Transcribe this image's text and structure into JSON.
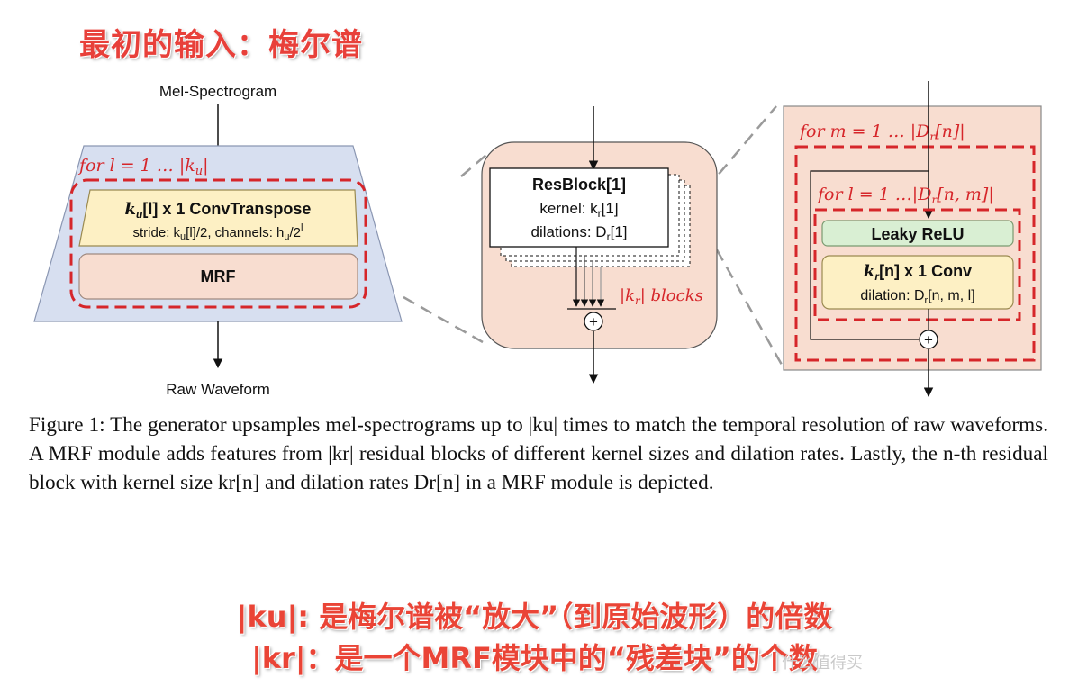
{
  "annotations": {
    "top_title": "最初的输入：梅尔谱",
    "bottom_line1": "|ku|: 是梅尔谱被“放大”（到原始波形）的倍数",
    "bottom_line2": "|kr|：是一个MRF模块中的“残差块”的个数",
    "watermark": "什么值得买"
  },
  "left_panel": {
    "input_label": "Mel-Spectrogram",
    "output_label": "Raw Waveform",
    "loop_label": "for  l = 1 … |k",
    "loop_sub": "u",
    "loop_end": "|",
    "conv_title_k": "k",
    "conv_title_sub": "u",
    "conv_title_rest": "[l] x 1  ConvTranspose",
    "conv_params": "stride: k",
    "conv_params_sub": "u",
    "conv_params_mid": "[l]/2, channels: h",
    "conv_params_sub2": "u",
    "conv_params_end": "/2",
    "conv_params_sup": "l",
    "mrf_label": "MRF"
  },
  "middle_panel": {
    "resblock_title": "ResBlock[1]",
    "kernel_label": "kernel: k",
    "kernel_sub": "r",
    "kernel_end": "[1]",
    "dilations_label": "dilations: D",
    "dilations_sub": "r",
    "dilations_end": "[1]",
    "blocks_label_pre": "|k",
    "blocks_label_sub": "r",
    "blocks_label_post": "| blocks",
    "sum_symbol": "+"
  },
  "right_panel": {
    "outer_loop": "for  m = 1 … |D",
    "outer_loop_sub": "r",
    "outer_loop_end": "[n]|",
    "inner_loop": "for  l = 1  …|D",
    "inner_loop_sub": "r",
    "inner_loop_end": "[n, m]|",
    "relu_label": "Leaky ReLU",
    "conv_k": "k",
    "conv_sub": "r",
    "conv_rest": "[n] x 1  Conv",
    "dilation_label": "dilation: D",
    "dilation_sub": "r",
    "dilation_end": "[n, m, l]",
    "sum_symbol": "+"
  },
  "caption": "Figure 1: The generator upsamples mel-spectrograms up to |ku| times to match the temporal resolution of raw waveforms. A MRF module adds features from |kr| residual blocks of different kernel sizes and dilation rates. Lastly, the n-th residual block with kernel size kr[n] and dilation rates Dr[n] in a MRF module is depicted.",
  "colors": {
    "red_accent": "#d6262a",
    "annotation_red": "#ea4436",
    "blue_panel": "#d7dff0",
    "peach_panel": "#f8ddd0",
    "yellow_box": "#fdf0c4",
    "green_box": "#d9efd3"
  }
}
